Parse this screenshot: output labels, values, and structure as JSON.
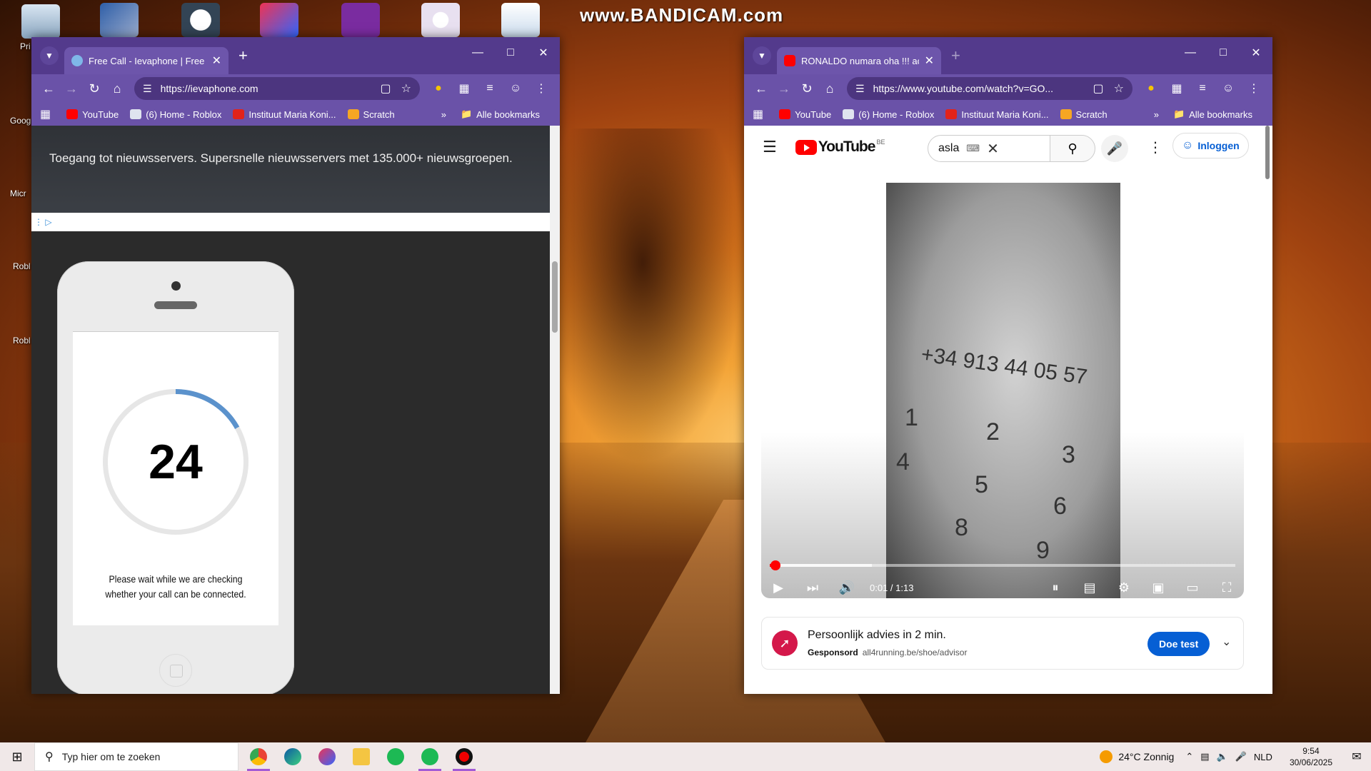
{
  "watermark": "www.BANDICAM.com",
  "desktop": {
    "labels": [
      "Pri",
      "Goog",
      "Micr",
      "Robl",
      "Robl"
    ]
  },
  "left_window": {
    "tab_title": "Free Call - Ievaphone | Free call",
    "url": "https://ievaphone.com",
    "bookmarks": [
      "YouTube",
      "(6) Home - Roblox",
      "Instituut Maria Koni...",
      "Scratch"
    ],
    "bookmarks_more": "»",
    "all_bookmarks": "Alle bookmarks",
    "ad_text": "Toegang tot nieuwsservers. Supersnelle nieuwsservers met 135.000+ nieuwsgroepen.",
    "countdown": "24",
    "countdown_progress_fraction": 0.17,
    "wait_line1": "Please wait while we are checking",
    "wait_line2": "whether your call can be connected."
  },
  "right_window": {
    "tab_title": "RONALDO numara oha !!! açtım",
    "url": "https://www.youtube.com/watch?v=GO...",
    "bookmarks": [
      "YouTube",
      "(6) Home - Roblox",
      "Instituut Maria Koni...",
      "Scratch"
    ],
    "bookmarks_more": "»",
    "all_bookmarks": "Alle bookmarks",
    "youtube": {
      "logo_text": "YouTube",
      "country_code": "BE",
      "search_value": "asla",
      "login_label": "Inloggen"
    },
    "video": {
      "phone_number": "+34 913 44 05 57",
      "time_display": "0:01 / 1:13",
      "played_fraction": 0.013,
      "buffered_fraction": 0.22
    },
    "ad": {
      "title": "Persoonlijk advies in 2 min.",
      "sponsored": "Gesponsord",
      "domain": "all4running.be/shoe/advisor",
      "cta": "Doe test"
    }
  },
  "taskbar": {
    "search_placeholder": "Typ hier om te zoeken",
    "weather": "24°C Zonnig",
    "language": "NLD",
    "time": "9:54",
    "date": "30/06/2025"
  },
  "colors": {
    "browser_frame": "#533a8c",
    "browser_toolbar": "#6a52a8",
    "youtube_red": "#ff0000",
    "link_blue": "#065fd4"
  }
}
